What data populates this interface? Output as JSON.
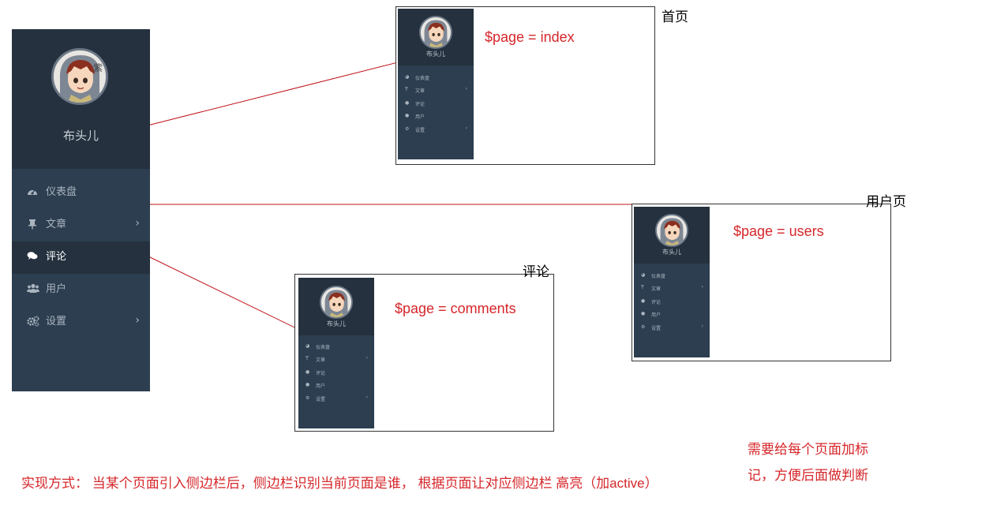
{
  "sidebar": {
    "user_name": "布头儿",
    "items": [
      {
        "label": "仪表盘",
        "icon": "dashboard-icon",
        "has_submenu": false,
        "active": false
      },
      {
        "label": "文章",
        "icon": "pin-icon",
        "has_submenu": true,
        "active": false
      },
      {
        "label": "评论",
        "icon": "comments-icon",
        "has_submenu": false,
        "active": true
      },
      {
        "label": "用户",
        "icon": "users-icon",
        "has_submenu": false,
        "active": false
      },
      {
        "label": "设置",
        "icon": "gears-icon",
        "has_submenu": true,
        "active": false
      }
    ]
  },
  "screens": {
    "index": {
      "caption": "首页",
      "code": "$page = index"
    },
    "users": {
      "caption": "用户页",
      "code": "$page = users"
    },
    "comments": {
      "caption": "评论",
      "code": "$page = comments"
    }
  },
  "notes": {
    "bottom": "实现方式： 当某个页面引入侧边栏后，侧边栏识别当前页面是谁， 根据页面让对应侧边栏 高亮（加active）",
    "right_line1": "需要给每个页面加标",
    "right_line2": "记，方便后面做判断"
  },
  "colors": {
    "sidebar_bg": "#2c3e50",
    "sidebar_dark": "#25313e",
    "annotation": "#d6262a",
    "connector": "#c0141a"
  }
}
